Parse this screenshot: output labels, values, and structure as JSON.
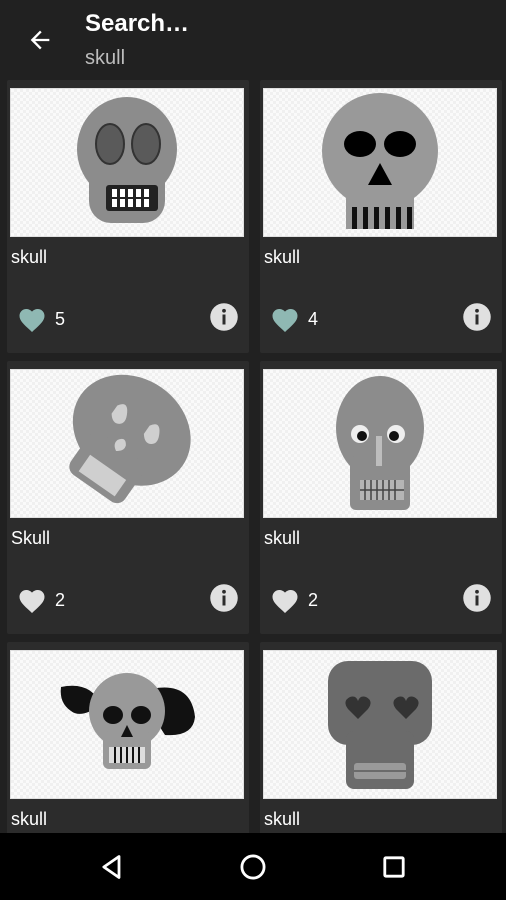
{
  "header": {
    "title": "Search…",
    "subtitle": "skull"
  },
  "colors": {
    "liked_heart": "#8fb8b3",
    "heart": "#e0e0e0",
    "card_bg": "#2c2c2c",
    "app_bg": "#212121"
  },
  "results": [
    {
      "label": "skull",
      "likes": "5",
      "liked": true
    },
    {
      "label": "skull",
      "likes": "4",
      "liked": true
    },
    {
      "label": "Skull",
      "likes": "2",
      "liked": false
    },
    {
      "label": "skull",
      "likes": "2",
      "liked": false
    },
    {
      "label": "skull",
      "likes": "",
      "liked": false
    },
    {
      "label": "skull",
      "likes": "",
      "liked": false
    }
  ],
  "icons": {
    "back": "arrow-back-icon",
    "like": "heart-icon",
    "info": "info-icon",
    "nav_back": "triangle-back-icon",
    "nav_home": "circle-home-icon",
    "nav_recents": "square-recents-icon"
  }
}
